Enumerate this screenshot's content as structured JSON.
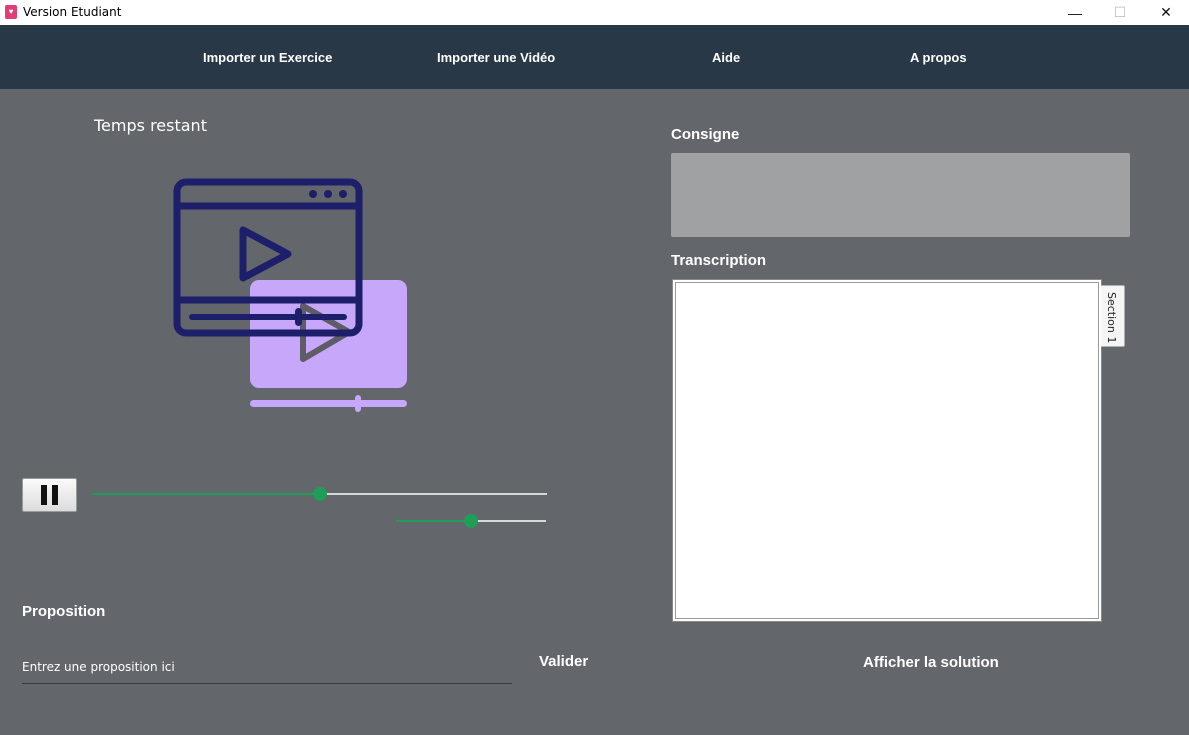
{
  "window": {
    "title": "Version Etudiant",
    "icon_glyph": "♥",
    "minimize_glyph": "—",
    "maximize_glyph": "☐",
    "close_glyph": "✕"
  },
  "menu": {
    "items": [
      {
        "label": "Importer un Exercice"
      },
      {
        "label": "Importer une Vidéo"
      },
      {
        "label": "Aide"
      },
      {
        "label": "A propos"
      }
    ]
  },
  "player": {
    "time_label": "Temps restant",
    "progress_fraction": 0.5,
    "volume_fraction": 0.5
  },
  "consigne": {
    "label": "Consigne",
    "text": ""
  },
  "transcription": {
    "label": "Transcription",
    "text": "",
    "tabs": [
      {
        "label": "Section 1"
      }
    ]
  },
  "proposition": {
    "label": "Proposition",
    "placeholder": "Entrez une proposition ici",
    "value": ""
  },
  "actions": {
    "validate_label": "Valider",
    "solution_label": "Afficher la solution"
  },
  "colors": {
    "menubar": "#283846",
    "background": "#63666a",
    "slider_accent": "#1e9e58",
    "illustration_navy": "#1d1f6b",
    "illustration_lavender": "#c6a7fa"
  }
}
